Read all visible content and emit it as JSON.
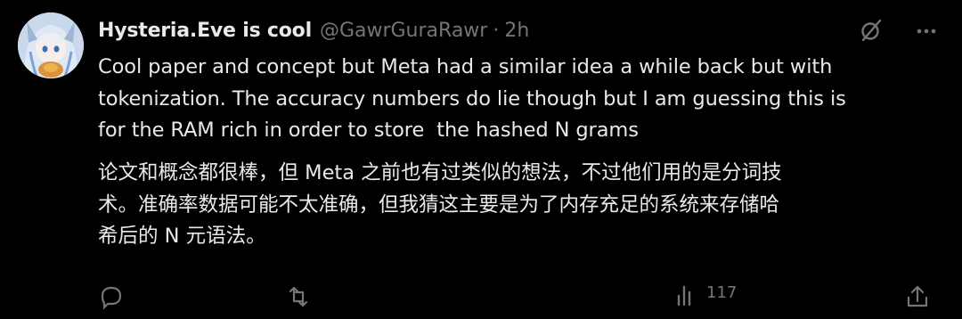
{
  "tweet": {
    "author": {
      "display_name": "Hysteria.Eve is cool",
      "handle": "@GawrGuraRawr",
      "separator": "·",
      "time": "2h"
    },
    "body_lines": "Cool paper and concept but Meta had a similar idea a while back but with\ntokenization. The accuracy numbers do lie though but I am guessing this is\nfor the RAM rich in order to store  the hashed N grams",
    "translation_lines": "论文和概念都很棒，但 Meta 之前也有过类似的想法，不过他们用的是分词技\n术。准确率数据可能不太准确，但我猜这主要是为了内存充足的系统来存储哈\n希后的 N 元语法。",
    "actions": {
      "views_count": "117"
    },
    "icons": {
      "grok": "grok-slash-icon",
      "more": "more-dots-icon",
      "reply": "reply-icon",
      "retweet": "retweet-icon",
      "views": "views-bar-icon",
      "share": "share-icon"
    }
  },
  "colors": {
    "background": "#000000",
    "text": "#e7e9ea",
    "muted": "#71767b"
  }
}
